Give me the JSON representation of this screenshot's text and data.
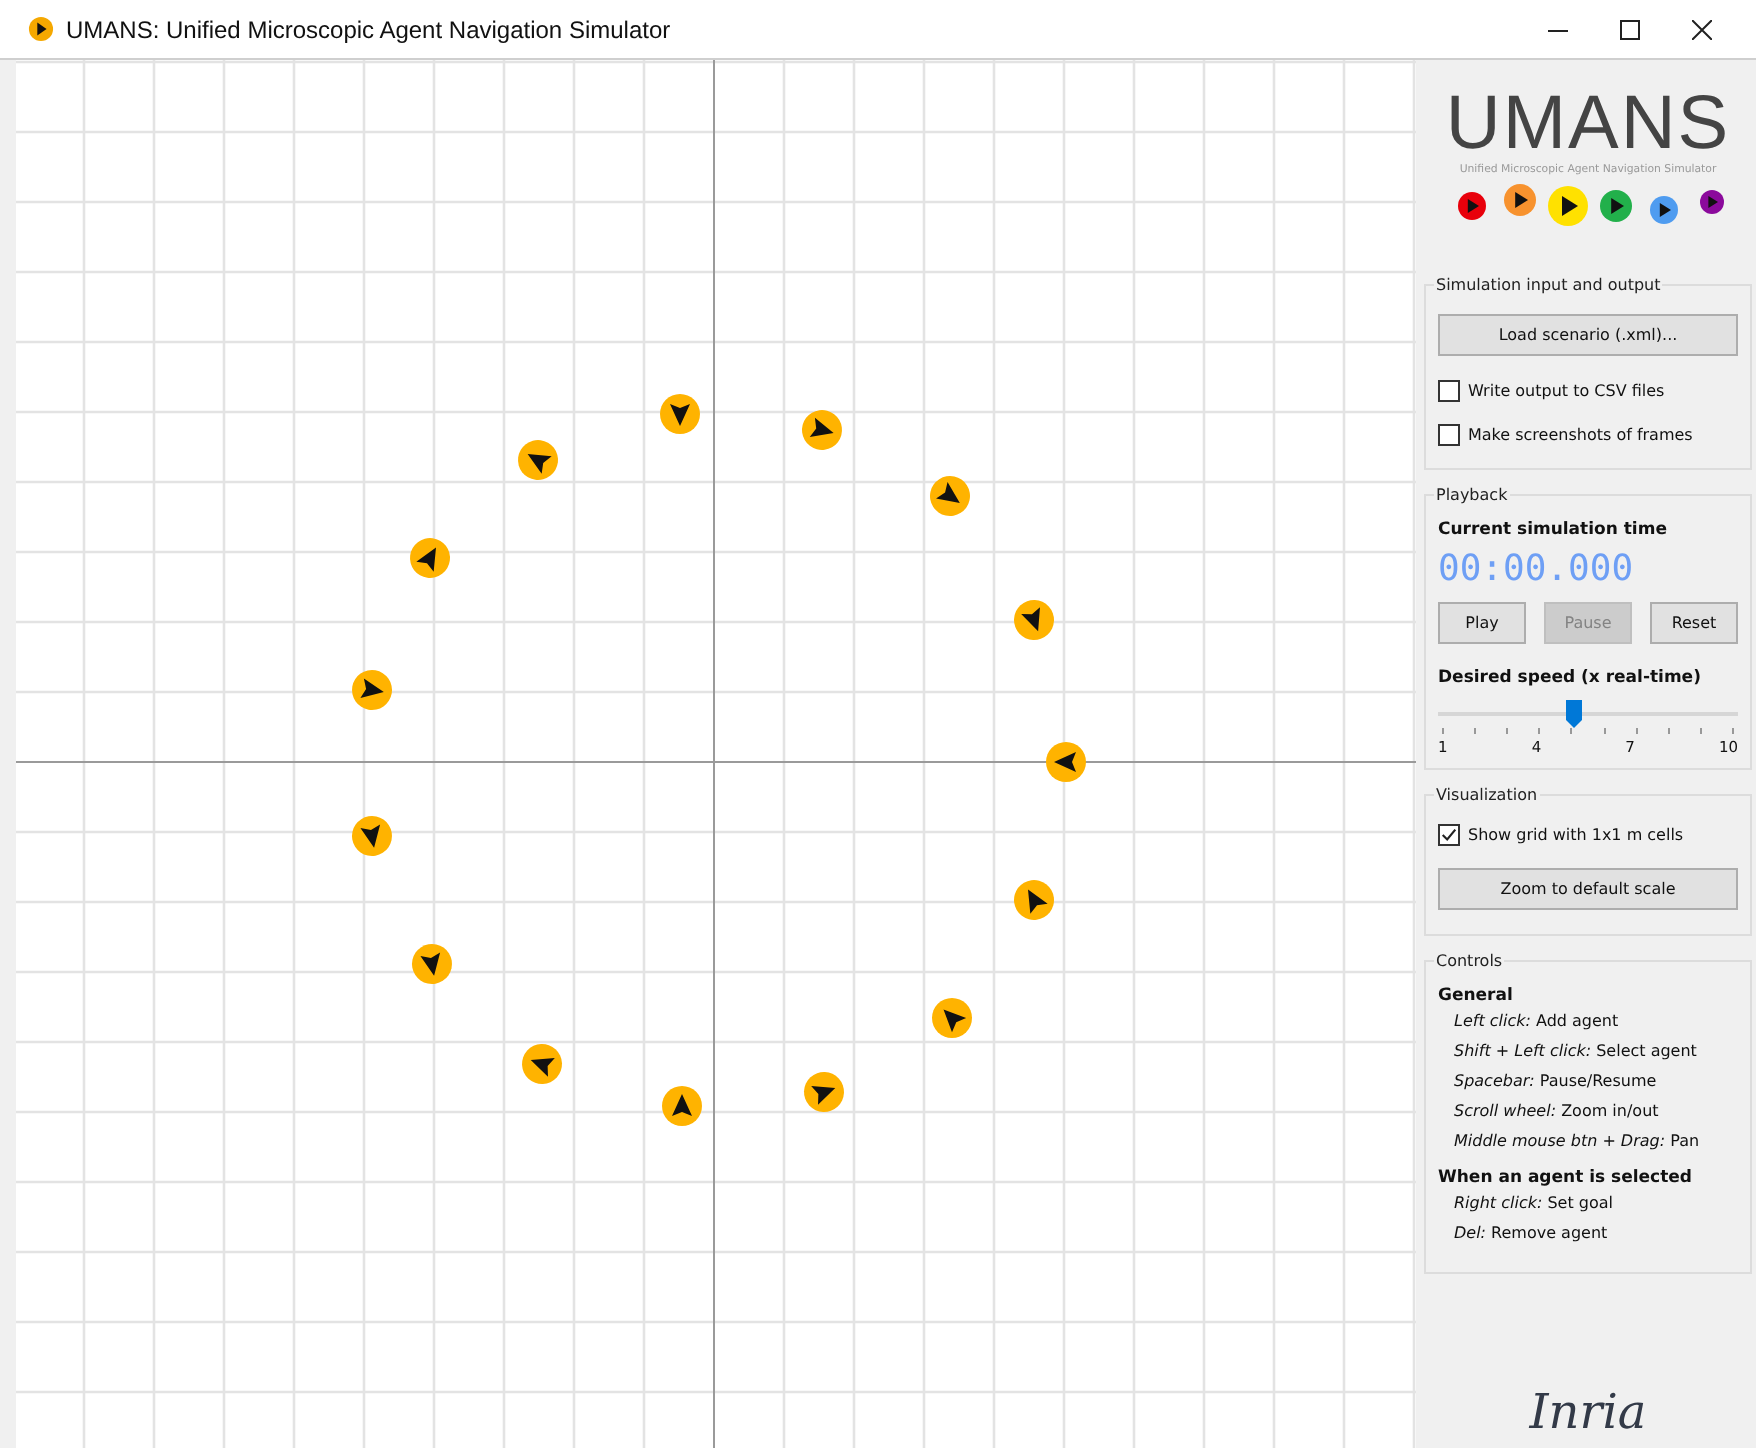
{
  "window": {
    "title": "UMANS: Unified Microscopic Agent Navigation Simulator"
  },
  "logo": {
    "title": "UMANS",
    "subtitle": "Unified Microscopic Agent Navigation Simulator"
  },
  "io": {
    "heading": "Simulation input and output",
    "load_button": "Load scenario (.xml)...",
    "options": [
      {
        "label": "Write output to CSV files",
        "checked": false
      },
      {
        "label": "Make screenshots of frames",
        "checked": false
      }
    ]
  },
  "playback": {
    "heading": "Playback",
    "time_label": "Current simulation time",
    "time": "00:00.000",
    "buttons": [
      {
        "label": "Play",
        "disabled": false
      },
      {
        "label": "Pause",
        "disabled": true
      },
      {
        "label": "Reset",
        "disabled": false
      }
    ],
    "speed_label": "Desired speed (x real-time)",
    "speed": {
      "level": 0.45,
      "ticks": [
        "1",
        "4",
        "7",
        "10"
      ]
    }
  },
  "visualization": {
    "heading": "Visualization",
    "options": [
      {
        "label": "Show grid with 1x1 m cells",
        "checked": true
      }
    ],
    "zoom_button": "Zoom to default scale"
  },
  "controls": {
    "heading": "Controls",
    "sections": [
      {
        "title": "General",
        "items": [
          "*Left click:* Add agent",
          "*Shift + Left click:* Select agent",
          "*Spacebar:* Pause/Resume",
          "*Scroll wheel:* Zoom in/out",
          "*Middle mouse btn + Drag:* Pan"
        ]
      },
      {
        "title": "When an agent is selected",
        "items": [
          "*Right click:* Set goal",
          "*Del:* Remove agent"
        ]
      }
    ]
  },
  "footer_logo": "Inria"
}
